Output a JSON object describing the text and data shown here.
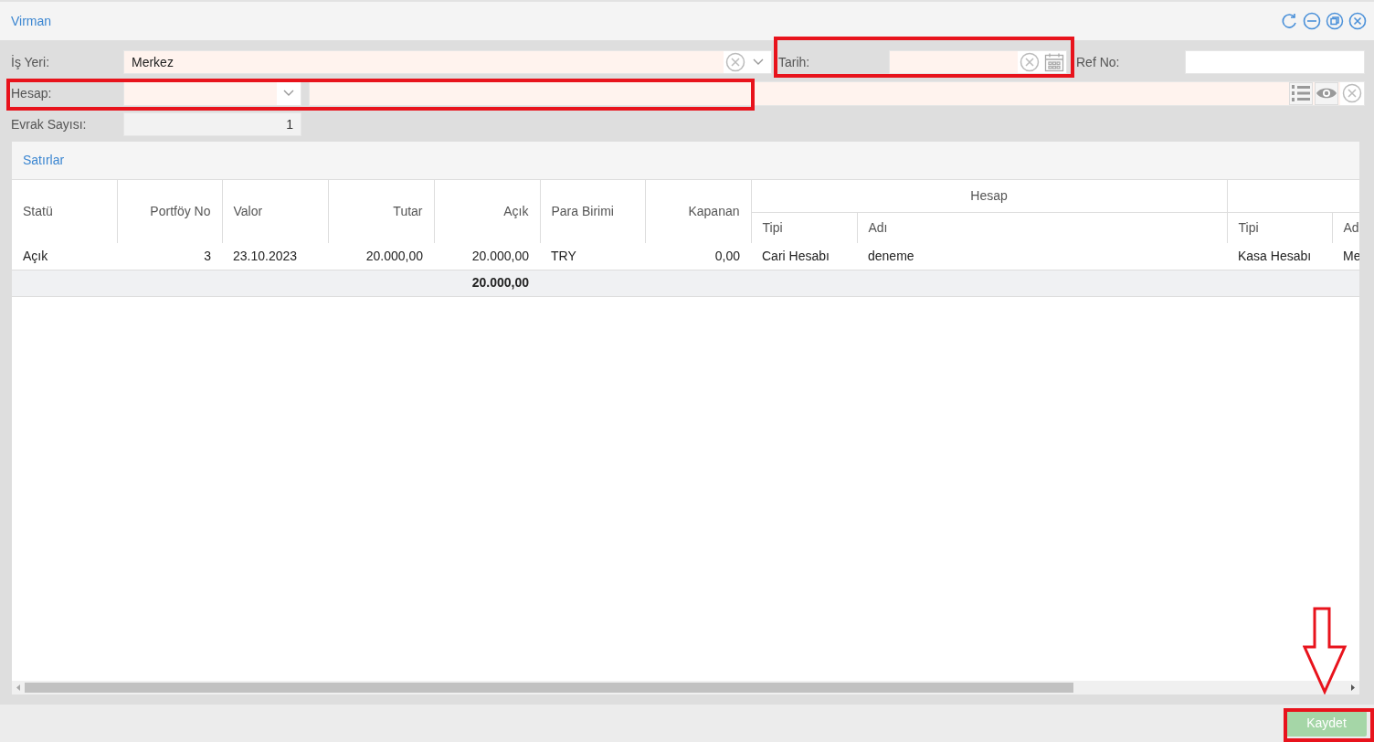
{
  "window": {
    "title": "Virman"
  },
  "title_buttons": [
    {
      "kind": "refresh"
    },
    {
      "kind": "minimize"
    },
    {
      "kind": "restore"
    },
    {
      "kind": "close"
    }
  ],
  "form": {
    "is_yeri": {
      "label": "İş Yeri:",
      "value": "Merkez"
    },
    "tarih": {
      "label": "Tarih:",
      "highlighted": true
    },
    "ref_no": {
      "label": "Ref No:"
    },
    "hesap": {
      "label": "Hesap:",
      "highlighted": true
    },
    "evrak_sayisi": {
      "label": "Evrak Sayısı:",
      "value": "1"
    }
  },
  "panel": {
    "title": "Satırlar"
  },
  "table": {
    "columns": [
      {
        "label": "Statü"
      },
      {
        "label": "Portföy No"
      },
      {
        "label": "Valor"
      },
      {
        "label": "Tutar"
      },
      {
        "label": "Açık",
        "total": "20.000,00"
      },
      {
        "label": "Para Birimi"
      },
      {
        "label": "Kapanan"
      }
    ],
    "groups": [
      {
        "label": "Hesap",
        "columns": [
          "Tipi",
          "Adı"
        ]
      },
      {
        "columns": [
          "Tipi",
          "Ad"
        ]
      }
    ],
    "rows": [
      [
        "Açık",
        "3",
        "23.10.2023",
        "20.000,00",
        "20.000,00",
        "TRY",
        "0,00",
        "Cari Hesabı",
        "deneme",
        "Kasa Hesabı",
        "Me"
      ]
    ]
  },
  "save_button": {
    "label": "Kaydet",
    "highlighted": true,
    "pointer_arrow": true
  }
}
